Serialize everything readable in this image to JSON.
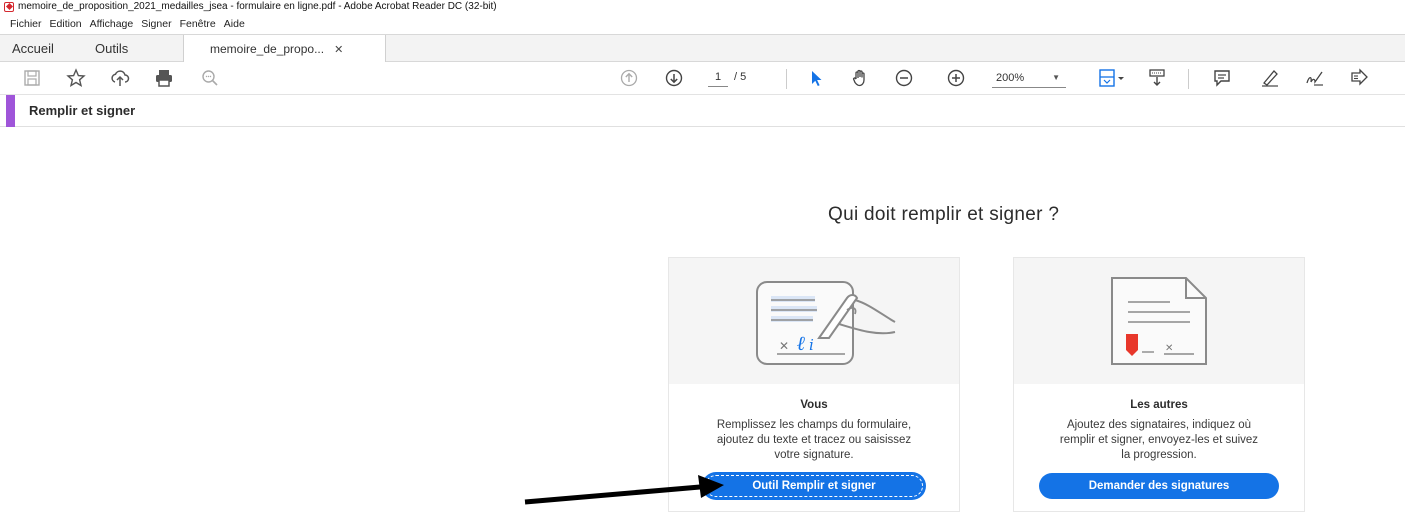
{
  "window": {
    "title": "memoire_de_proposition_2021_medailles_jsea - formulaire en ligne.pdf - Adobe Acrobat Reader DC (32-bit)"
  },
  "menu": [
    "Fichier",
    "Edition",
    "Affichage",
    "Signer",
    "Fenêtre",
    "Aide"
  ],
  "tabs": {
    "home": "Accueil",
    "tools": "Outils",
    "document": "memoire_de_propo...",
    "close": "✕"
  },
  "toolbar": {
    "page_current": "1",
    "page_total": "/ 5",
    "zoom": "200%",
    "icons": [
      "save-icon",
      "bookmark-star-icon",
      "upload-cloud-icon",
      "print-icon",
      "search-icon",
      "page-up-icon",
      "page-down-icon",
      "select-arrow-icon",
      "hand-icon",
      "zoom-out-icon",
      "zoom-in-icon",
      "fit-page-icon",
      "scroll-mode-icon",
      "comment-icon",
      "highlight-icon",
      "sign-icon",
      "fill-sign-icon"
    ]
  },
  "panel": {
    "title": "Remplir et signer",
    "accent_color": "#9f55d9"
  },
  "main": {
    "question": "Qui doit remplir et signer ?",
    "cards": [
      {
        "title": "Vous",
        "description_lines": [
          "Remplissez les champs du formulaire,",
          "ajoutez du texte et tracez ou saisissez",
          "votre signature."
        ],
        "button": "Outil Remplir et signer"
      },
      {
        "title": "Les autres",
        "description_lines": [
          "Ajoutez des signataires, indiquez où",
          "remplir et signer, envoyez-les et suivez",
          "la progression."
        ],
        "button": "Demander des signatures"
      }
    ]
  },
  "colors": {
    "button": "#1473e6",
    "accent": "#9f55d9"
  }
}
